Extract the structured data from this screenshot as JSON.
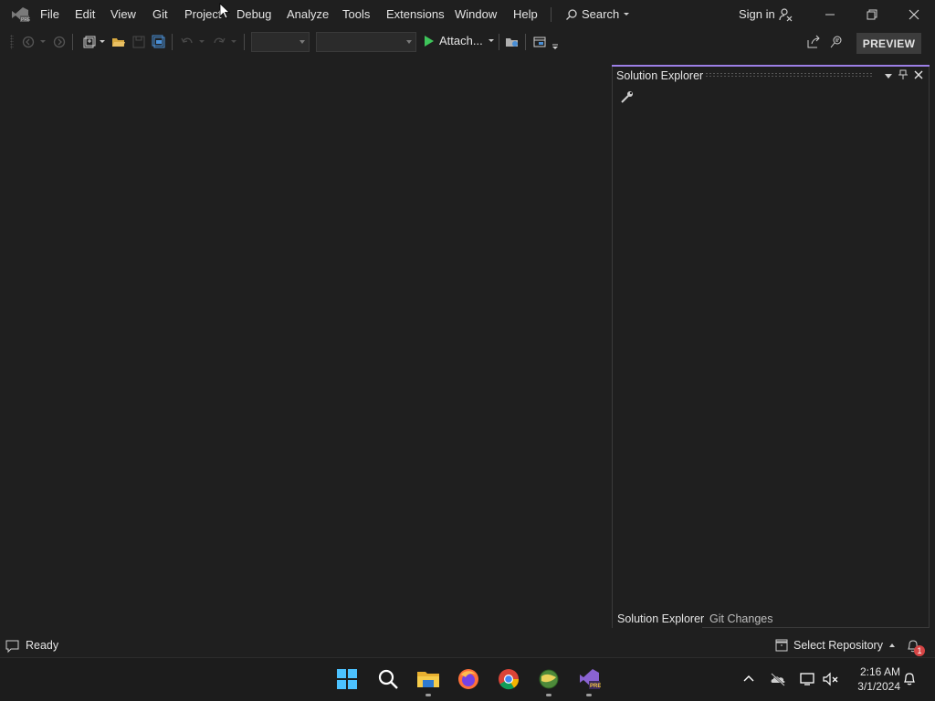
{
  "menu": {
    "items": [
      "File",
      "Edit",
      "View",
      "Git",
      "Project",
      "Debug",
      "Analyze",
      "Tools",
      "Extensions",
      "Window",
      "Help"
    ],
    "search_label": "Search",
    "sign_in_label": "Sign in"
  },
  "toolbar": {
    "attach_label": "Attach...",
    "preview_label": "PREVIEW"
  },
  "solution_explorer": {
    "title": "Solution Explorer",
    "tabs": [
      "Solution Explorer",
      "Git Changes"
    ]
  },
  "status_bar": {
    "status_text": "Ready",
    "repo_label": "Select Repository",
    "notification_count": "1"
  },
  "taskbar": {
    "time": "2:16 AM",
    "date": "3/1/2024"
  },
  "colors": {
    "accent": "#9c7fe6",
    "background": "#1f1f1f",
    "play_green": "#3ec45a"
  }
}
